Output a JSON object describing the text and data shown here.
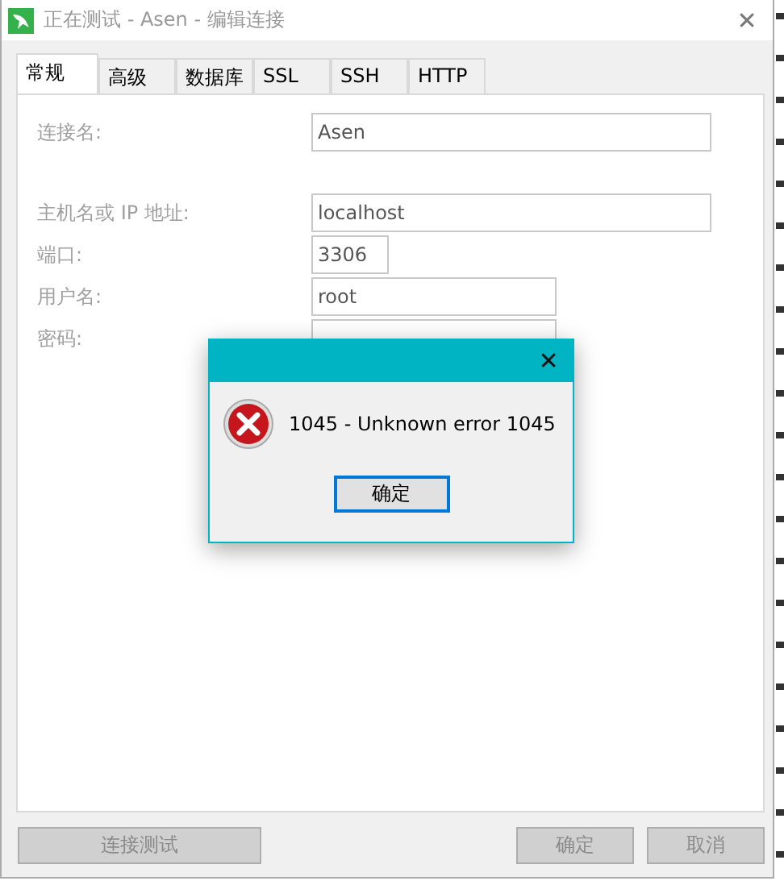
{
  "window": {
    "title": "正在测试 - Asen - 编辑连接",
    "close": "✕"
  },
  "tabs": [
    {
      "label": "常规",
      "selected": true
    },
    {
      "label": "高级",
      "selected": false
    },
    {
      "label": "数据库",
      "selected": false
    },
    {
      "label": "SSL",
      "selected": false
    },
    {
      "label": "SSH",
      "selected": false
    },
    {
      "label": "HTTP",
      "selected": false
    }
  ],
  "fields": [
    {
      "label": "连接名:",
      "value": "Asen"
    },
    {
      "label": "主机名或 IP 地址:",
      "value": "localhost"
    },
    {
      "label": "端口:",
      "value": "3306"
    },
    {
      "label": "用户名:",
      "value": "root"
    },
    {
      "label": "密码:"
    }
  ],
  "buttons": [
    {
      "label": "连接测试",
      "disabled": true,
      "kind": "left"
    },
    {
      "label": "确定",
      "disabled": true,
      "kind": "right"
    },
    {
      "label": "取消",
      "disabled": true,
      "kind": "right"
    }
  ],
  "error_dialog": {
    "close": "✕",
    "message": "1045 - Unknown error 1045",
    "button": "确定"
  }
}
